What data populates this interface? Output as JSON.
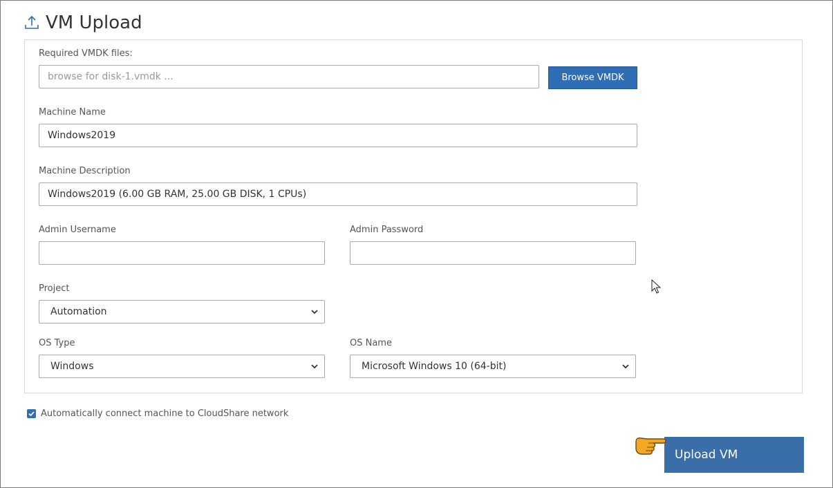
{
  "page": {
    "title": "VM Upload",
    "title_icon": "upload-icon"
  },
  "form": {
    "vmdk": {
      "label": "Required VMDK files:",
      "placeholder": "browse for disk-1.vmdk ...",
      "browse_label": "Browse VMDK"
    },
    "machine_name": {
      "label": "Machine Name",
      "value": "Windows2019"
    },
    "machine_description": {
      "label": "Machine Description",
      "value": "Windows2019 (6.00 GB RAM, 25.00 GB DISK, 1 CPUs)"
    },
    "admin_username": {
      "label": "Admin Username",
      "value": ""
    },
    "admin_password": {
      "label": "Admin Password",
      "value": ""
    },
    "project": {
      "label": "Project",
      "selected": "Automation"
    },
    "os_type": {
      "label": "OS Type",
      "selected": "Windows"
    },
    "os_name": {
      "label": "OS Name",
      "selected": "Microsoft Windows 10 (64-bit)"
    }
  },
  "auto_connect": {
    "checked": true,
    "label": "Automatically connect machine to CloudShare network"
  },
  "upload_button": {
    "label": "Upload VM"
  },
  "colors": {
    "primary_button": "#2f6db5",
    "upload_button": "#3a6ea8",
    "hand_pointer": "#f5a623"
  }
}
